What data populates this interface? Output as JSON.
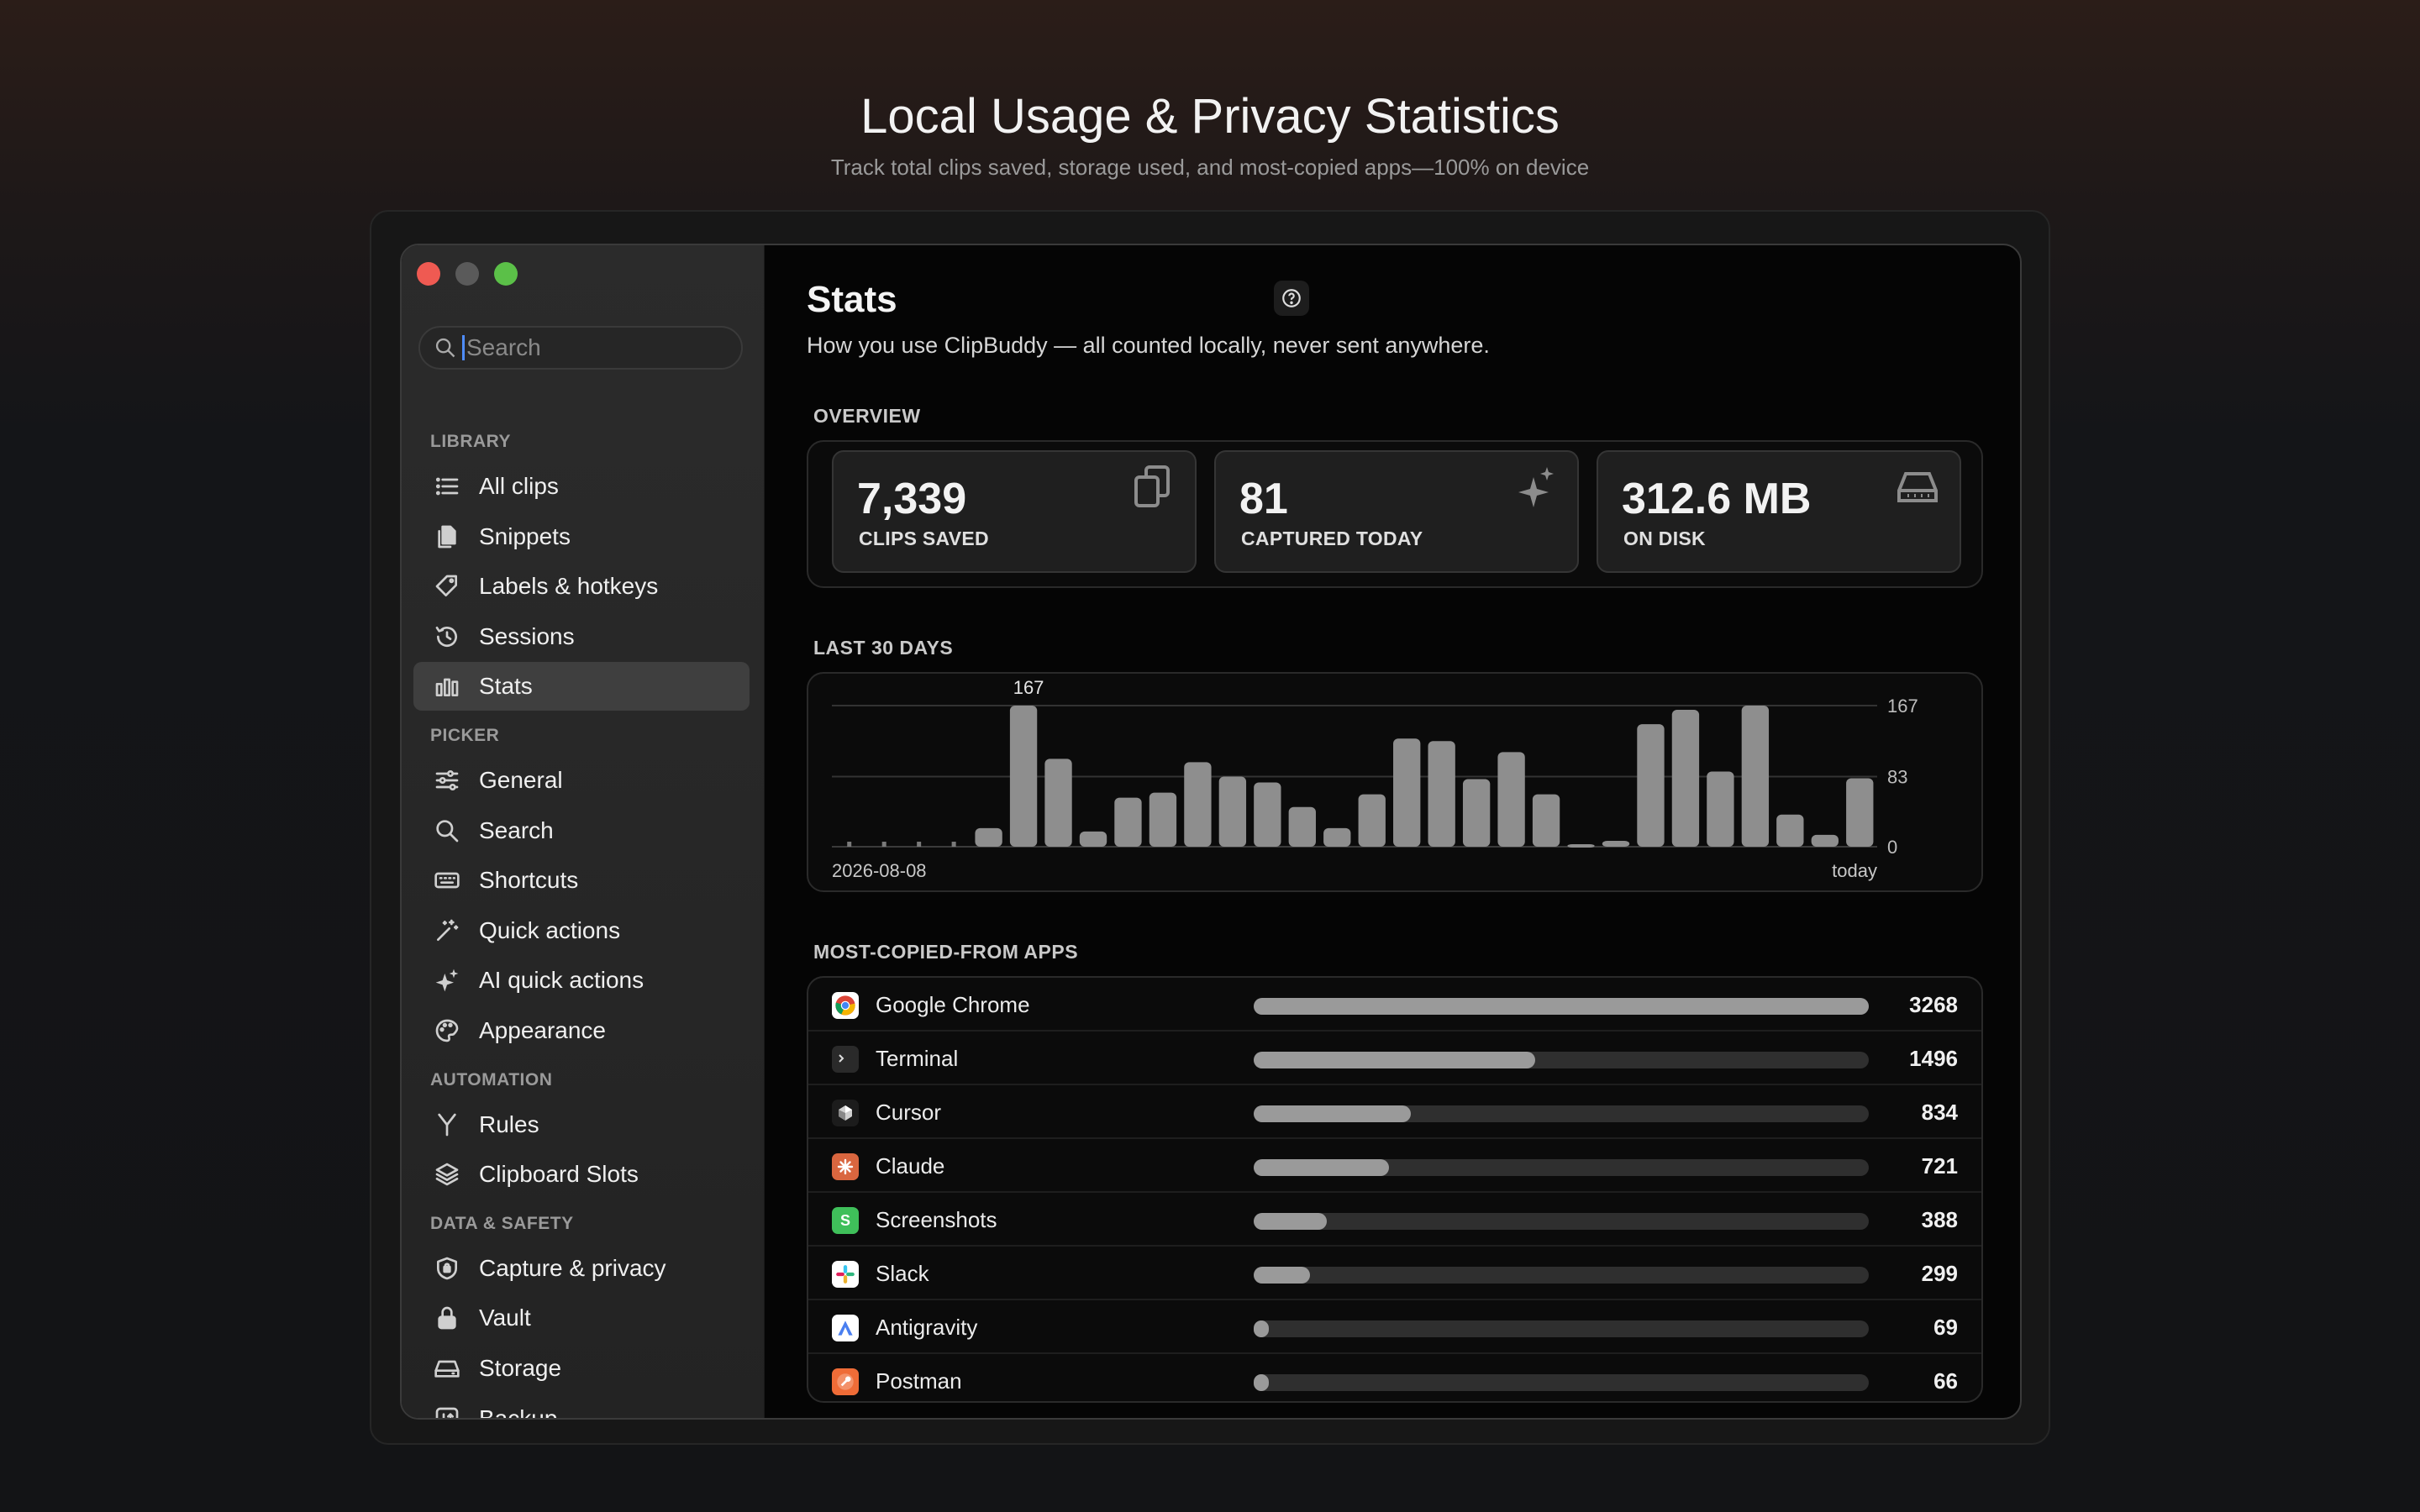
{
  "hero": {
    "title": "Local Usage & Privacy Statistics",
    "subtitle": "Track total clips saved, storage used, and most-copied apps—100% on device"
  },
  "sidebar": {
    "search_placeholder": "Search",
    "sections": [
      {
        "label": "LIBRARY",
        "items": [
          {
            "label": "All clips",
            "icon": "list-icon"
          },
          {
            "label": "Snippets",
            "icon": "documents-icon"
          },
          {
            "label": "Labels & hotkeys",
            "icon": "tag-icon"
          },
          {
            "label": "Sessions",
            "icon": "history-icon"
          },
          {
            "label": "Stats",
            "icon": "bar-chart-icon",
            "active": true
          }
        ]
      },
      {
        "label": "PICKER",
        "items": [
          {
            "label": "General",
            "icon": "sliders-icon"
          },
          {
            "label": "Search",
            "icon": "search-icon"
          },
          {
            "label": "Shortcuts",
            "icon": "keyboard-icon"
          },
          {
            "label": "Quick actions",
            "icon": "wand-icon"
          },
          {
            "label": "AI quick actions",
            "icon": "sparkles-icon"
          },
          {
            "label": "Appearance",
            "icon": "palette-icon"
          }
        ]
      },
      {
        "label": "AUTOMATION",
        "items": [
          {
            "label": "Rules",
            "icon": "fork-icon"
          },
          {
            "label": "Clipboard Slots",
            "icon": "stack-icon"
          }
        ]
      },
      {
        "label": "DATA & SAFETY",
        "items": [
          {
            "label": "Capture & privacy",
            "icon": "shield-icon"
          },
          {
            "label": "Vault",
            "icon": "lock-icon"
          },
          {
            "label": "Storage",
            "icon": "drive-icon"
          },
          {
            "label": "Backup",
            "icon": "backup-icon"
          }
        ]
      }
    ]
  },
  "main": {
    "title": "Stats",
    "subtitle": "How you use ClipBuddy — all counted locally, never sent anywhere.",
    "overview_heading": "OVERVIEW",
    "chart_heading": "LAST 30 DAYS",
    "apps_heading": "MOST-COPIED-FROM APPS",
    "stats": [
      {
        "value": "7,339",
        "label": "CLIPS SAVED",
        "icon": "clipboard-copy-icon"
      },
      {
        "value": "81",
        "label": "CAPTURED TODAY",
        "icon": "sparkles-icon"
      },
      {
        "value": "312.6 MB",
        "label": "ON DISK",
        "icon": "drive-icon"
      }
    ],
    "apps": [
      {
        "name": "Google Chrome",
        "count": 3268,
        "icon": "chrome-icon",
        "color": "#ffffff"
      },
      {
        "name": "Terminal",
        "count": 1496,
        "icon": "terminal-icon",
        "color": "#2a2a2a"
      },
      {
        "name": "Cursor",
        "count": 834,
        "icon": "cursor-app-icon",
        "color": "#1c1c1c"
      },
      {
        "name": "Claude",
        "count": 721,
        "icon": "claude-icon",
        "color": "#d9663f"
      },
      {
        "name": "Screenshots",
        "count": 388,
        "icon": "screenshots-icon",
        "color": "#3fbf5a"
      },
      {
        "name": "Slack",
        "count": 299,
        "icon": "slack-icon",
        "color": "#ffffff"
      },
      {
        "name": "Antigravity",
        "count": 69,
        "icon": "antigravity-icon",
        "color": "#ffffff"
      },
      {
        "name": "Postman",
        "count": 66,
        "icon": "postman-icon",
        "color": "#ef6c37"
      }
    ]
  },
  "chart_data": {
    "type": "bar",
    "x_start_label": "2026-08-08",
    "x_end_label": "today",
    "values": [
      0,
      0,
      0,
      0,
      22,
      167,
      104,
      18,
      58,
      64,
      100,
      83,
      76,
      47,
      22,
      62,
      128,
      125,
      80,
      112,
      62,
      3,
      7,
      145,
      162,
      89,
      167,
      38,
      14,
      81
    ],
    "peak_label": "167",
    "yticks": [
      0,
      83,
      167
    ],
    "ylim": [
      0,
      167
    ],
    "grid": true
  }
}
